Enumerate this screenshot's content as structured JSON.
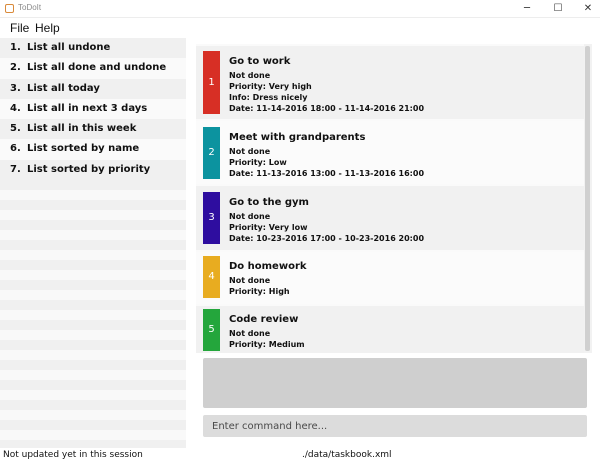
{
  "window": {
    "title": "ToDoIt",
    "minimize_glyph": "─",
    "maximize_glyph": "☐",
    "close_glyph": "✕"
  },
  "menu": {
    "file": "File",
    "help": "Help"
  },
  "commands": [
    {
      "num": "1.",
      "label": "List all undone"
    },
    {
      "num": "2.",
      "label": "List all done and undone"
    },
    {
      "num": "3.",
      "label": "List all today"
    },
    {
      "num": "4.",
      "label": "List all in next 3 days"
    },
    {
      "num": "5.",
      "label": "List all in this week"
    },
    {
      "num": "6.",
      "label": "List sorted by name"
    },
    {
      "num": "7.",
      "label": "List sorted by priority"
    }
  ],
  "tasks": [
    {
      "index": "1",
      "color": "#d72f25",
      "name": "Go to work",
      "status": "Not done",
      "priority": "Priority: Very high",
      "info": "Info: Dress nicely",
      "date": "Date: 11-14-2016 18:00 - 11-14-2016 21:00"
    },
    {
      "index": "2",
      "color": "#0c939f",
      "name": "Meet with grandparents",
      "status": "Not done",
      "priority": "Priority: Low",
      "date": "Date: 11-13-2016 13:00 - 11-13-2016 16:00"
    },
    {
      "index": "3",
      "color": "#2e0d9f",
      "name": "Go to the gym",
      "status": "Not done",
      "priority": "Priority: Very low",
      "date": "Date: 10-23-2016 17:00 - 10-23-2016 20:00"
    },
    {
      "index": "4",
      "color": "#e8ac20",
      "name": "Do homework",
      "status": "Not done",
      "priority": "Priority: High"
    },
    {
      "index": "5",
      "color": "#24a63c",
      "name": "Code review",
      "status": "Not done",
      "priority": "Priority: Medium"
    }
  ],
  "command_box": {
    "placeholder": "Enter command here..."
  },
  "status": {
    "sync": "Not updated yet in this session",
    "file_path": "./data/taskbook.xml"
  }
}
